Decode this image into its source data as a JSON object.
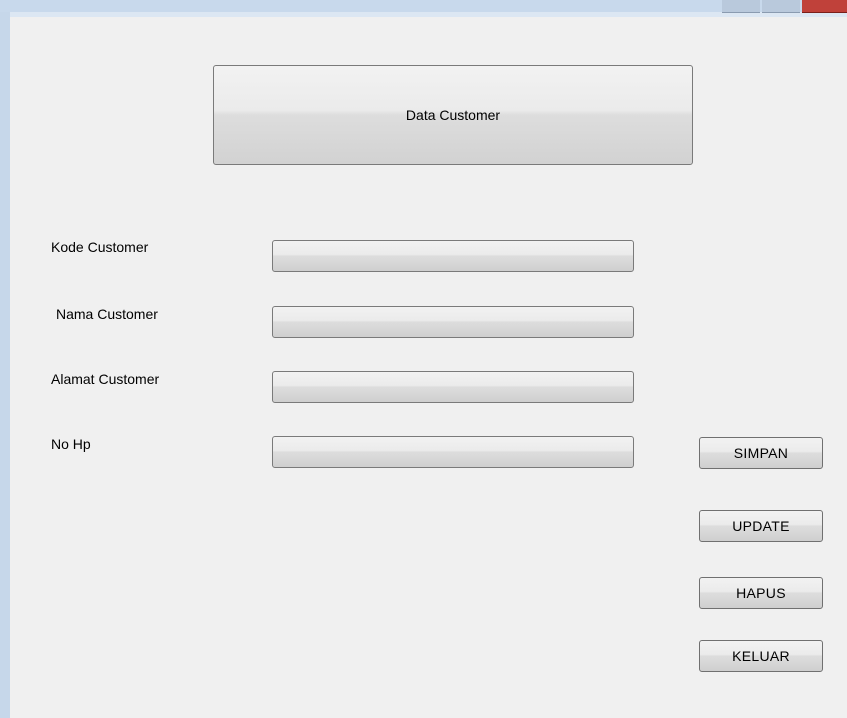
{
  "form": {
    "title": "Data Customer",
    "fields": [
      {
        "label": "Kode Customer",
        "value": ""
      },
      {
        "label": "Nama Customer",
        "value": ""
      },
      {
        "label": "Alamat Customer",
        "value": ""
      },
      {
        "label": "No Hp",
        "value": ""
      }
    ],
    "buttons": {
      "save": "SIMPAN",
      "update": "UPDATE",
      "delete": "HAPUS",
      "exit": "KELUAR"
    }
  }
}
